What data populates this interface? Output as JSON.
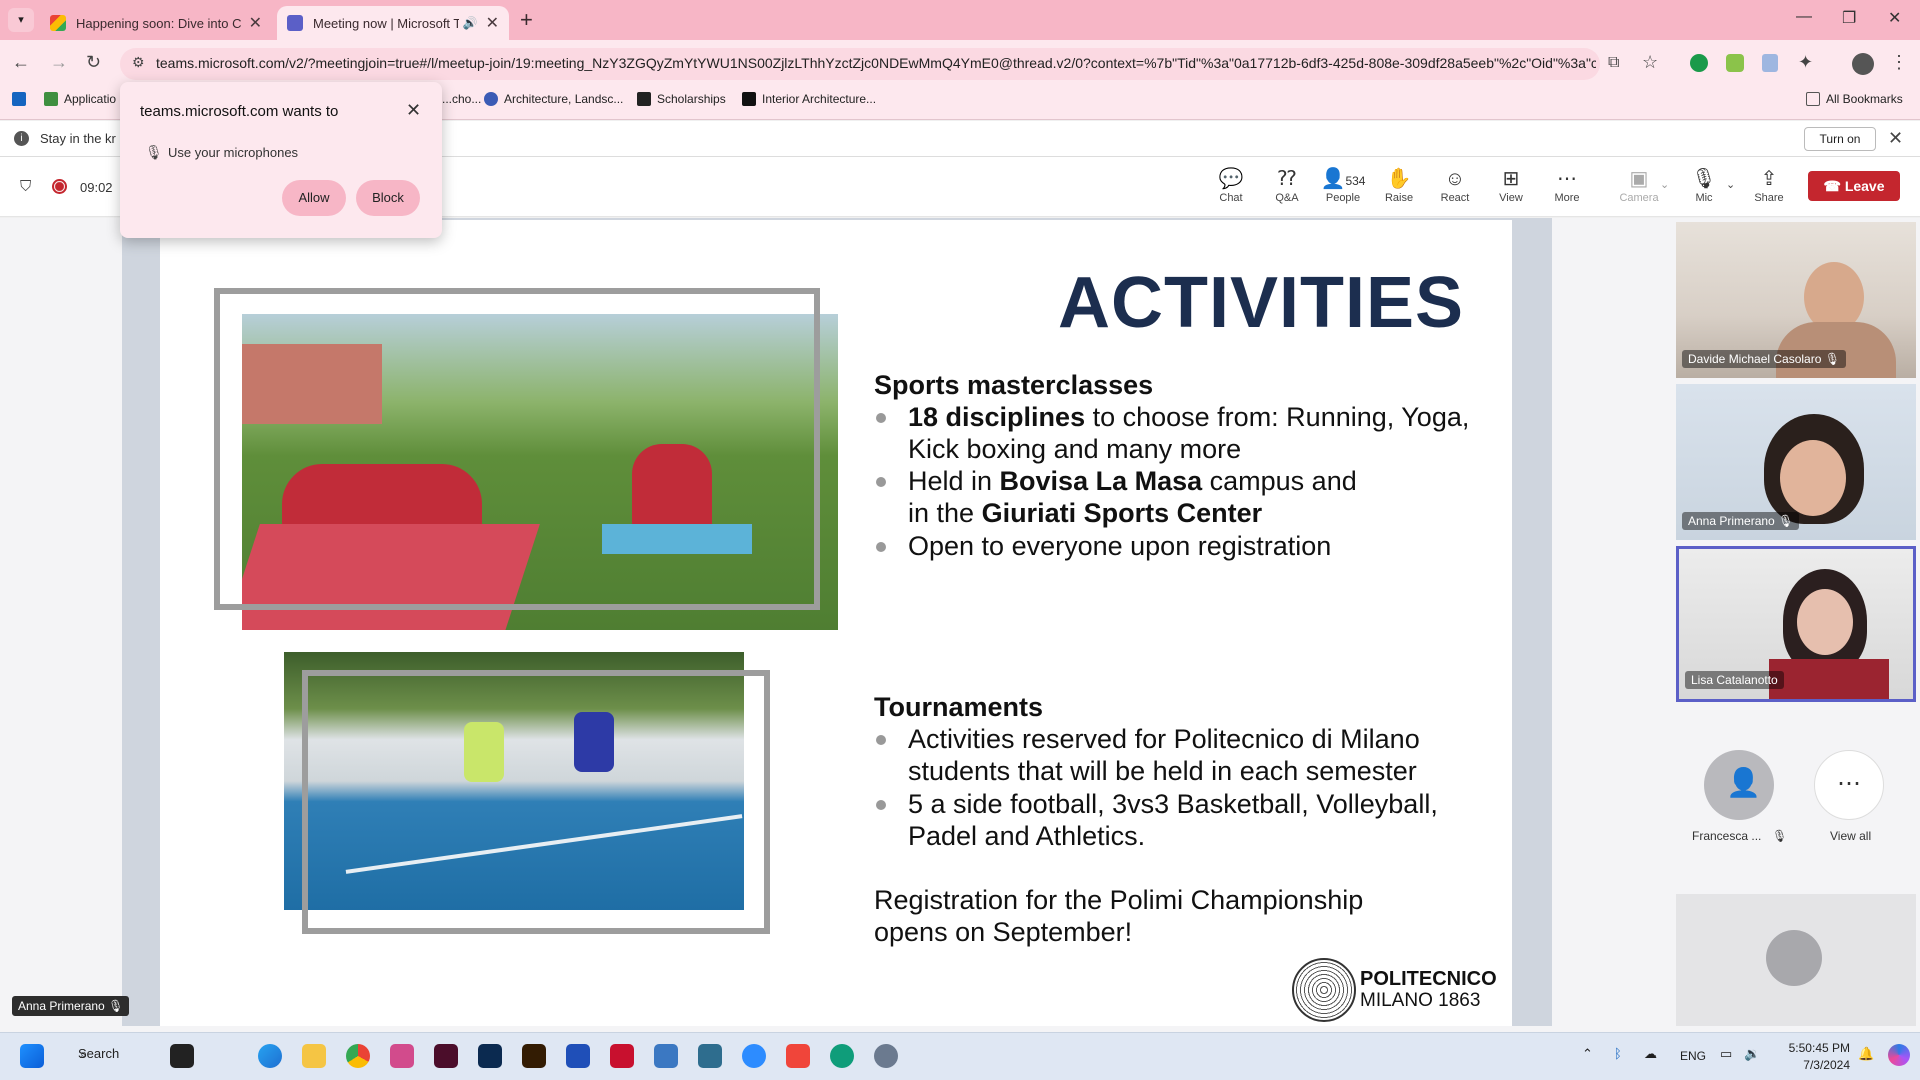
{
  "browser": {
    "tabs": [
      {
        "title": "Happening soon: Dive into Cam",
        "close": "✕"
      },
      {
        "title": "Meeting now | Microsoft Te",
        "close": "✕"
      }
    ],
    "new_tab": "+",
    "url": "teams.microsoft.com/v2/?meetingjoin=true#/l/meetup-join/19:meeting_NzY3ZGQyZmYtYWU1NS00ZjlzLThhYzctZjc0NDEwMmQ4YmE0@thread.v2/0?context=%7b\"Tid\"%3a\"0a17712b-6df3-425d-808e-309df28a5eeb\"%2c\"Oid\"%3a\"c...",
    "bookmarks": [
      "Applicatio",
      "...cho...",
      "Architecture, Landsc...",
      "Scholarships",
      "Interior Architecture..."
    ],
    "all_bookmarks": "All Bookmarks"
  },
  "permission_popup": {
    "title": "teams.microsoft.com wants to",
    "request": "Use your microphones",
    "allow": "Allow",
    "block": "Block"
  },
  "infobar": {
    "text": "Stay in the kr",
    "turn_on": "Turn on"
  },
  "meeting": {
    "timer": "09:02",
    "controls": {
      "chat": "Chat",
      "qa": "Q&A",
      "people": "People",
      "people_count": "534",
      "raise": "Raise",
      "react": "React",
      "view": "View",
      "more": "More",
      "camera": "Camera",
      "mic": "Mic",
      "share": "Share",
      "leave": "Leave"
    }
  },
  "slide": {
    "heading": "ACTIVITIES",
    "section1": {
      "title": "Sports masterclasses",
      "bullets": [
        {
          "bold": "18 disciplines",
          "rest": " to choose from: Running, Yoga,",
          "line2": "Kick boxing and many more"
        },
        {
          "pre": "Held in ",
          "bold": "Bovisa La Masa",
          "rest": " campus and",
          "line2_pre": "in the ",
          "line2_bold": "Giuriati Sports Center"
        },
        {
          "rest": "Open to everyone upon registration"
        }
      ]
    },
    "section2": {
      "title": "Tournaments",
      "bullets": [
        {
          "line1": "Activities reserved for Politecnico di Milano",
          "line2": "students that will be held in each semester"
        },
        {
          "line1": "5 a side football, 3vs3 Basketball, Volleyball,",
          "line2": "Padel and Athletics."
        }
      ]
    },
    "registration": {
      "line1": "Registration for the Polimi Championship",
      "line2": "opens on September!"
    },
    "logo": {
      "name": "POLITECNICO",
      "city": "MILANO 1863"
    }
  },
  "participants": [
    {
      "name": "Davide Michael Casolaro"
    },
    {
      "name": "Anna Primerano"
    },
    {
      "name": "Lisa Catalanotto"
    }
  ],
  "overflow": {
    "francesca": "Francesca ...",
    "view_all": "View all"
  },
  "self_label": "Anna Primerano",
  "taskbar": {
    "search": "Search",
    "lang": "ENG",
    "time": "5:50:45 PM",
    "date": "7/3/2024"
  }
}
